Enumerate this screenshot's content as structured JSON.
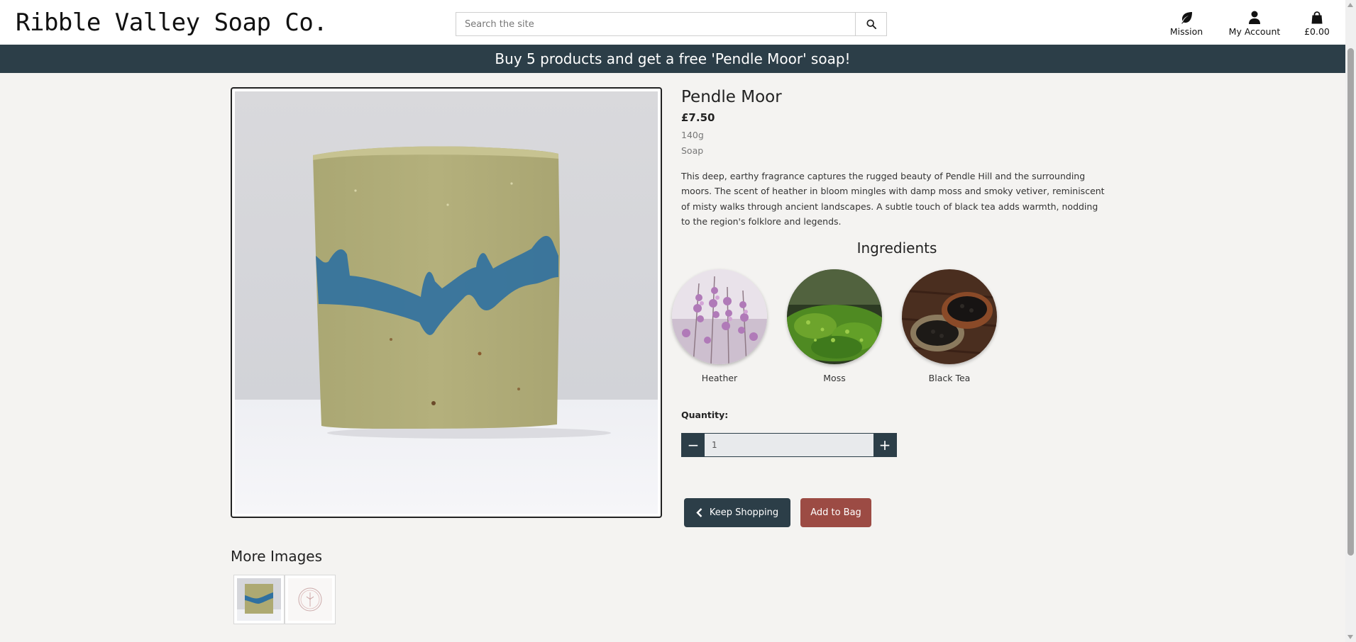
{
  "header": {
    "brand": "Ribble Valley Soap Co.",
    "search_placeholder": "Search the site",
    "nav": {
      "mission": "Mission",
      "account": "My Account",
      "bag_total": "£0.00"
    }
  },
  "promo": "Buy 5 products and get a free 'Pendle Moor' soap!",
  "product": {
    "name": "Pendle Moor",
    "price": "£7.50",
    "weight": "140g",
    "category": "Soap",
    "description": "This deep, earthy fragrance captures the rugged beauty of Pendle Hill and the surrounding moors. The scent of heather in bloom mingles with damp moss and smoky vetiver, reminiscent of misty walks through ancient landscapes. A subtle touch of black tea adds warmth, nodding to the region's folklore and legends."
  },
  "ingredients": {
    "title": "Ingredients",
    "items": [
      {
        "name": "Heather"
      },
      {
        "name": "Moss"
      },
      {
        "name": "Black Tea"
      }
    ]
  },
  "purchase": {
    "quantity_label": "Quantity:",
    "quantity_value": "1",
    "minus": "−",
    "plus": "+",
    "keep_shopping": "Keep Shopping",
    "add_to_bag": "Add to Bag"
  },
  "gallery": {
    "title": "More Images"
  },
  "colors": {
    "primary": "#2c3e48",
    "accent": "#9c4b44",
    "background": "#f4f3f1"
  }
}
